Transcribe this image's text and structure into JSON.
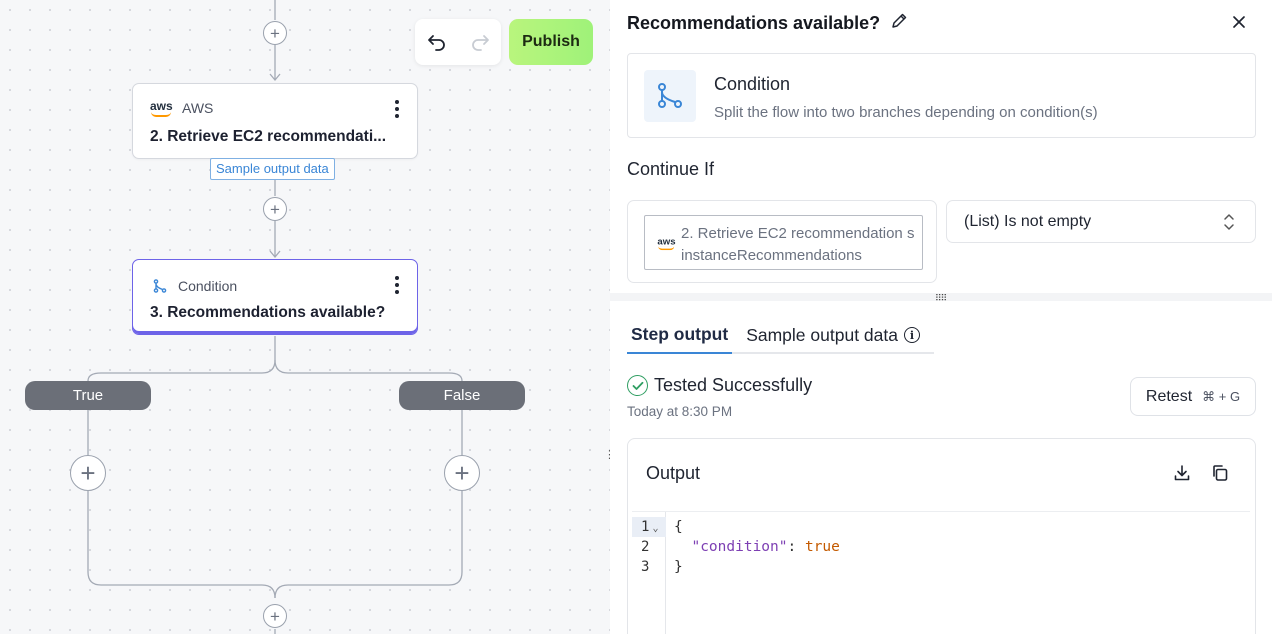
{
  "toolbar": {
    "publish_label": "Publish"
  },
  "canvas": {
    "step2": {
      "app": "AWS",
      "title": "2. Retrieve EC2 recommendati..."
    },
    "sample_tag": "Sample output data",
    "step3": {
      "type": "Condition",
      "title": "3. Recommendations available?"
    },
    "branch_true": "True",
    "branch_false": "False"
  },
  "panel": {
    "title": "Recommendations available?",
    "card": {
      "heading": "Condition",
      "description": "Split the flow into two branches depending on condition(s)"
    },
    "continue_if": "Continue If",
    "variable": "2. Retrieve EC2 recommendation s instanceRecommendations",
    "operator": "(List) Is not empty",
    "tabs": [
      "Step output",
      "Sample output data"
    ],
    "status": "Tested Successfully",
    "tested_at": "Today at 8:30 PM",
    "retest": {
      "label": "Retest",
      "shortcut": "⌘ + G"
    },
    "output": {
      "heading": "Output",
      "line_numbers": [
        "1",
        "2",
        "3"
      ],
      "lines": [
        "{",
        "\"condition\"",
        "true",
        "}"
      ]
    }
  },
  "colors": {
    "accent": "#6d63e8",
    "publish": "#a6f37b",
    "link": "#3a86d6",
    "success": "#2f9e62"
  }
}
